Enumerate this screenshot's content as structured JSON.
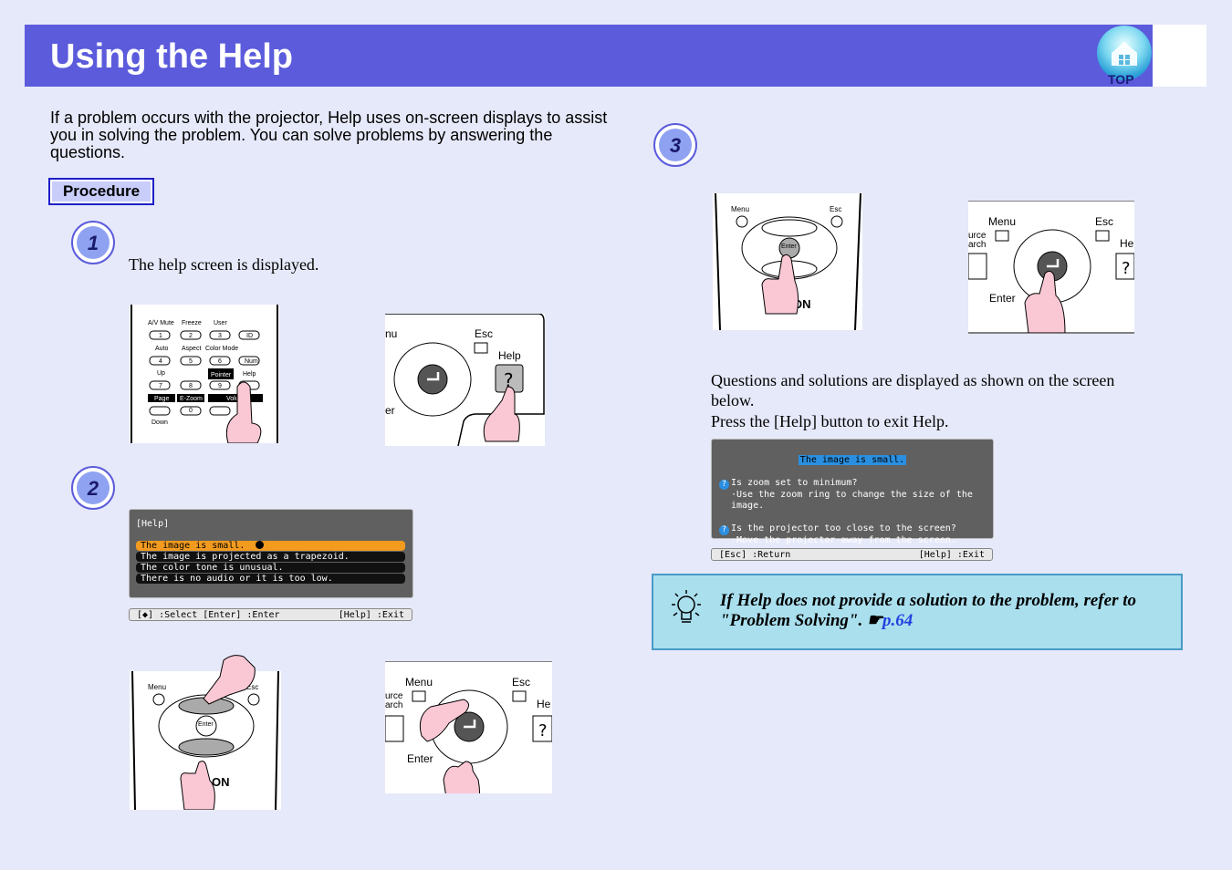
{
  "header": {
    "title": "Using the Help",
    "top_label": "TOP",
    "accent_color": "#5b5bdc"
  },
  "intro_text": "If a problem occurs with the projector, Help uses on-screen displays to assist you in solving the problem. You can solve problems by answering the questions.",
  "procedure_label": "Procedure",
  "steps": [
    {
      "number": "1",
      "text": "The help screen is displayed.",
      "remote_labels": {
        "row1": [
          "A/V Mute",
          "Freeze",
          "User"
        ],
        "row1_keys": [
          "1",
          "2",
          "3",
          "ID"
        ],
        "row2": [
          "Auto",
          "Aspect",
          "Color Mode"
        ],
        "row2_keys": [
          "4",
          "5",
          "6",
          "Num"
        ],
        "row3": [
          "Up",
          "Pointer",
          "Help"
        ],
        "row3_keys": [
          "7",
          "8",
          "9"
        ],
        "row4": [
          "Page",
          "E-Zoom",
          "Volume"
        ],
        "row4_keys": [
          "0"
        ],
        "row5": [
          "Down"
        ]
      },
      "panel_labels": {
        "menu": "nu",
        "esc": "Esc",
        "help": "Help",
        "enter": "er",
        "help_key": "?"
      }
    },
    {
      "number": "2",
      "help_screen": {
        "title": "[Help]",
        "items": [
          "The image is small.",
          "The image is projected as a trapezoid.",
          "The color tone is unusual.",
          "There is no audio or it is too low."
        ],
        "footer_left": "[◆] :Select  [Enter] :Enter",
        "footer_right": "[Help] :Exit"
      },
      "remote_labels": {
        "menu": "Menu",
        "esc": "Esc",
        "enter": "Enter",
        "brand": "ON"
      },
      "panel_labels": {
        "menu": "Menu",
        "esc": "Esc",
        "source": "urce",
        "search": "arch",
        "help": "He",
        "enter": "Enter",
        "help_key": "?"
      }
    },
    {
      "number": "3",
      "remote_labels": {
        "menu": "Menu",
        "esc": "Esc",
        "enter": "Enter",
        "brand": "ON"
      },
      "panel_labels": {
        "menu": "Menu",
        "esc": "Esc",
        "source": "urce",
        "search": "arch",
        "help": "He",
        "enter": "Enter",
        "help_key": "?"
      },
      "text_1": "Questions and solutions are displayed as shown on the screen below.",
      "text_2": "Press the [Help] button to exit Help.",
      "answer_screen": {
        "title": "The image is small.",
        "q1": "Is zoom set to minimum?",
        "a1": "·Use the zoom ring to change the size of the image.",
        "q2": "Is the projector too close to the screen?",
        "a2": "·Move the projector away from the screen.",
        "q_icon": "?",
        "footer_left": "[Esc] :Return",
        "footer_right": "[Help] :Exit"
      }
    }
  ],
  "hint": {
    "text": "If Help does not provide a solution to the problem, refer to \"Problem Solving\".",
    "ref_symbol": "☛",
    "link": "p.64"
  }
}
